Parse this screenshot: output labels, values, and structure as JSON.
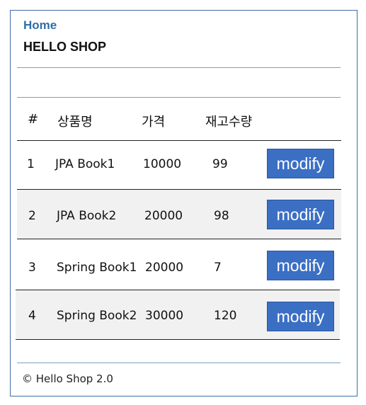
{
  "header": {
    "home_label": "Home",
    "brand": "HELLO SHOP"
  },
  "table": {
    "columns": [
      "#",
      "상품명",
      "가격",
      "재고수량"
    ],
    "rows": [
      {
        "id": "1",
        "name": "JPA Book1",
        "price": "10000",
        "stock": "99",
        "action": "modify"
      },
      {
        "id": "2",
        "name": "JPA Book2",
        "price": "20000",
        "stock": "98",
        "action": "modify"
      },
      {
        "id": "3",
        "name": "Spring Book1",
        "price": "20000",
        "stock": "7",
        "action": "modify"
      },
      {
        "id": "4",
        "name": "Spring Book2",
        "price": "30000",
        "stock": "120",
        "action": "modify"
      }
    ]
  },
  "footer": {
    "text": "© Hello Shop 2.0"
  },
  "colors": {
    "accent": "#2f6ea8",
    "button": "#3b6fc4",
    "row_alt": "#f1f1f1",
    "frame": "#3e6ea8"
  }
}
